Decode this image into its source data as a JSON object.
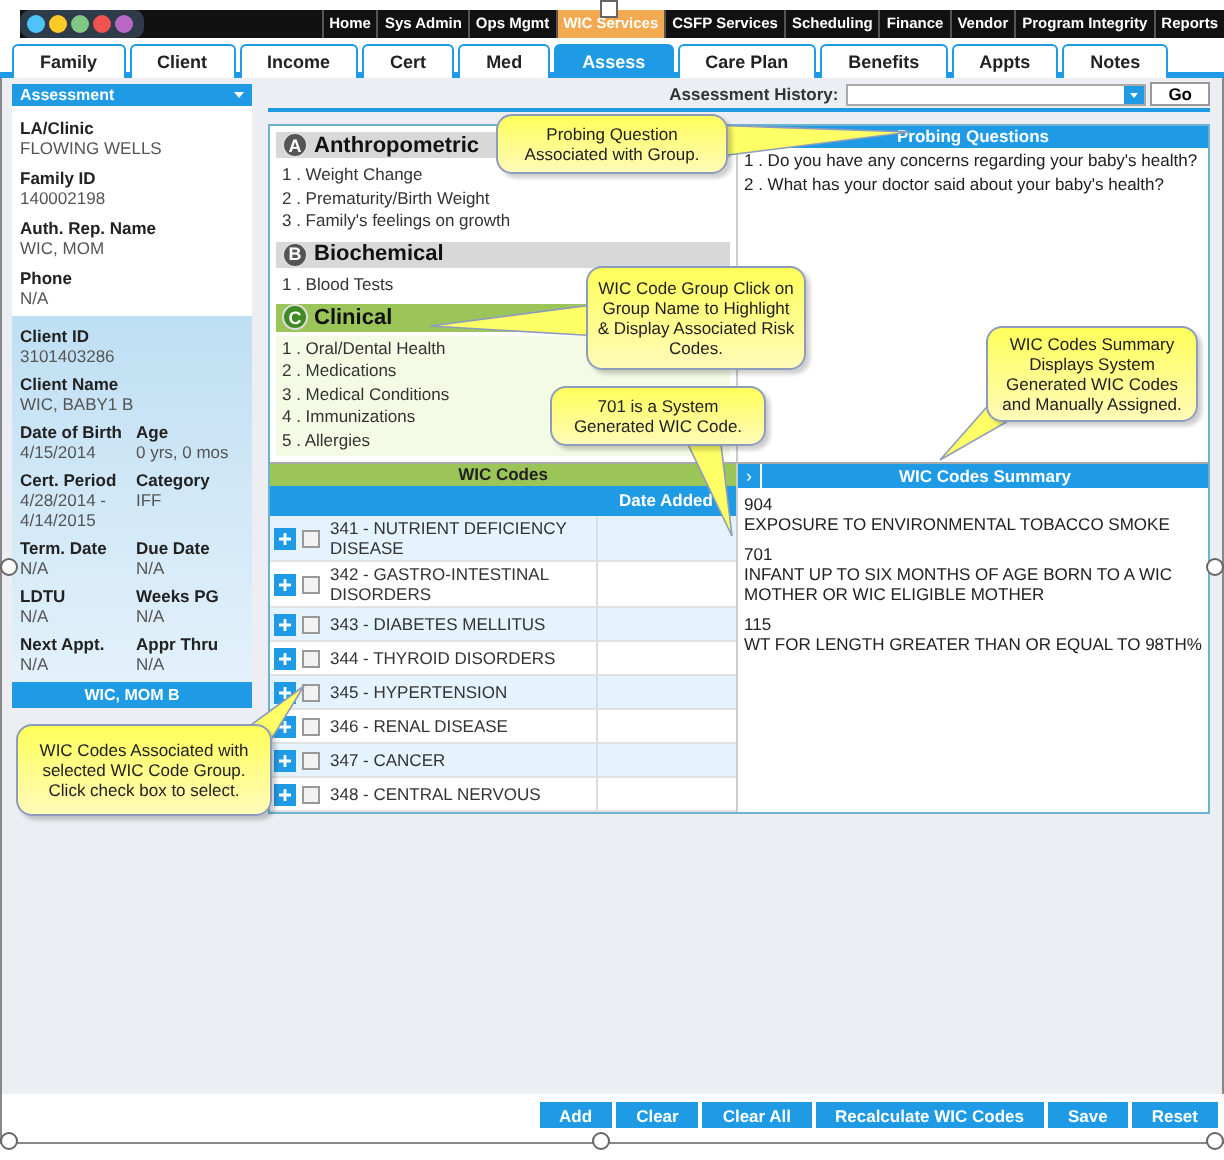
{
  "top_nav": [
    {
      "label": "Home",
      "selected": false
    },
    {
      "label": "Sys Admin",
      "selected": false
    },
    {
      "label": "Ops Mgmt",
      "selected": false
    },
    {
      "label": "WIC Services",
      "selected": true
    },
    {
      "label": "CSFP Services",
      "selected": false
    },
    {
      "label": "Scheduling",
      "selected": false
    },
    {
      "label": "Finance",
      "selected": false
    },
    {
      "label": "Vendor",
      "selected": false
    },
    {
      "label": "Program Integrity",
      "selected": false
    },
    {
      "label": "Reports",
      "selected": false
    }
  ],
  "tabs": [
    {
      "label": "Family",
      "selected": false
    },
    {
      "label": "Client",
      "selected": false
    },
    {
      "label": "Income",
      "selected": false
    },
    {
      "label": "Cert",
      "selected": false
    },
    {
      "label": "Med",
      "selected": false
    },
    {
      "label": "Assess",
      "selected": true
    },
    {
      "label": "Care Plan",
      "selected": false
    },
    {
      "label": "Benefits",
      "selected": false
    },
    {
      "label": "Appts",
      "selected": false
    },
    {
      "label": "Notes",
      "selected": false
    }
  ],
  "sidebar": {
    "header": "Assessment",
    "family_fields": [
      {
        "label": "LA/Clinic",
        "value": "FLOWING WELLS"
      },
      {
        "label": "Family ID",
        "value": "140002198"
      },
      {
        "label": "Auth. Rep. Name",
        "value": "WIC, MOM"
      },
      {
        "label": "Phone",
        "value": "N/A"
      }
    ],
    "client_fields": [
      {
        "label": "Client ID",
        "value": "3101403286"
      },
      {
        "label": "Client Name",
        "value": "WIC, BABY1 B"
      }
    ],
    "client_pairs": [
      [
        {
          "label": "Date of Birth",
          "value": "4/15/2014"
        },
        {
          "label": "Age",
          "value": "0 yrs, 0 mos"
        }
      ],
      [
        {
          "label": "Cert. Period",
          "value": "4/28/2014 - 4/14/2015"
        },
        {
          "label": "Category",
          "value": "IFF"
        }
      ],
      [
        {
          "label": "Term. Date",
          "value": "N/A"
        },
        {
          "label": "Due Date",
          "value": "N/A"
        }
      ],
      [
        {
          "label": "LDTU",
          "value": "N/A"
        },
        {
          "label": "Weeks PG",
          "value": "N/A"
        }
      ],
      [
        {
          "label": "Next Appt.",
          "value": "N/A"
        },
        {
          "label": "Appr Thru",
          "value": "N/A"
        }
      ]
    ],
    "footer_button": "WIC, MOM B"
  },
  "assessment_history": {
    "label": "Assessment History:",
    "button": "Go"
  },
  "groups": [
    {
      "letter": "A",
      "name": "Anthropometric",
      "selected": false,
      "items": [
        "1 . Weight Change",
        "2 . Prematurity/Birth Weight",
        "3 . Family's feelings on growth"
      ]
    },
    {
      "letter": "B",
      "name": "Biochemical",
      "selected": false,
      "items": [
        "1 . Blood Tests"
      ]
    },
    {
      "letter": "C",
      "name": "Clinical",
      "selected": true,
      "items": [
        "1 . Oral/Dental Health",
        "2 . Medications",
        "3 . Medical Conditions",
        "4 . Immunizations",
        "5 . Allergies"
      ]
    }
  ],
  "wic_codes": {
    "title": "WIC Codes",
    "column": "Date Added",
    "rows": [
      {
        "label": "341 - NUTRIENT DEFICIENCY DISEASE",
        "checked": false
      },
      {
        "label": "342 - GASTRO-INTESTINAL DISORDERS",
        "checked": false
      },
      {
        "label": "343 - DIABETES MELLITUS",
        "checked": false
      },
      {
        "label": "344 - THYROID DISORDERS",
        "checked": false
      },
      {
        "label": "345 - HYPERTENSION",
        "checked": false
      },
      {
        "label": "346 - RENAL DISEASE",
        "checked": false
      },
      {
        "label": "347 - CANCER",
        "checked": false
      },
      {
        "label": "348 - CENTRAL NERVOUS",
        "checked": false
      }
    ]
  },
  "probing_questions": {
    "title": "Probing Questions",
    "items": [
      "1 . Do you have any concerns regarding your baby's health?",
      "2 . What has your doctor said about your baby's health?"
    ]
  },
  "summary": {
    "toggle": "›",
    "title": "WIC Codes Summary",
    "entries": [
      {
        "code": "904",
        "description": "EXPOSURE TO ENVIRONMENTAL TOBACCO SMOKE"
      },
      {
        "code": "701",
        "description": "INFANT UP TO SIX MONTHS OF AGE BORN TO A WIC MOTHER OR WIC ELIGIBLE MOTHER"
      },
      {
        "code": "115",
        "description": "WT FOR LENGTH GREATER THAN OR EQUAL TO 98TH%"
      }
    ]
  },
  "callouts": [
    {
      "text": "Probing Question Associated with Group."
    },
    {
      "text": "WIC Code Group Click on Group Name to Highlight & Display Associated Risk Codes."
    },
    {
      "text": "701 is a System Generated WIC Code."
    },
    {
      "text": "WIC Codes Summary Displays System Generated WIC Codes and Manually Assigned."
    },
    {
      "text": "WIC Codes Associated with selected WIC Code Group. Click check box to select."
    }
  ],
  "buttons": [
    "Add",
    "Clear",
    "Clear All",
    "Recalculate WIC Codes",
    "Save",
    "Reset"
  ]
}
